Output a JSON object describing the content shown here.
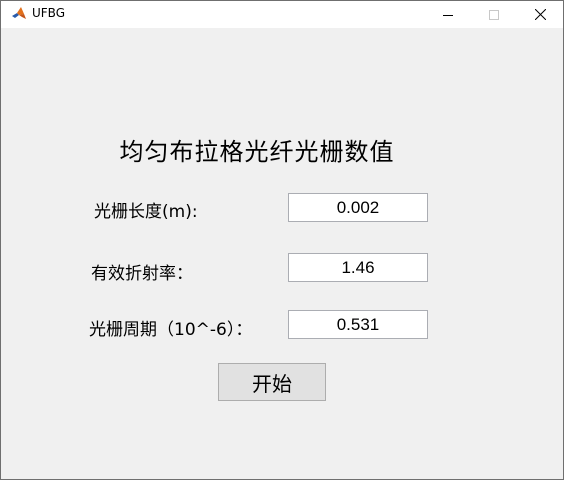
{
  "window": {
    "title": "UFBG",
    "icon": "matlab-icon",
    "controls": {
      "minimize_icon": "minimize-icon",
      "maximize_icon": "maximize-icon",
      "close_icon": "close-icon"
    }
  },
  "form": {
    "heading": "均匀布拉格光纤光栅数值",
    "fields": [
      {
        "label": "光栅长度(m):",
        "value": "0.002"
      },
      {
        "label": "有效折射率：",
        "value": "1.46"
      },
      {
        "label": "光栅周期（10^-6）：",
        "value": "0.531"
      }
    ],
    "start_button": "开始"
  },
  "colors": {
    "background": "#f0f0f0",
    "titlebar": "#ffffff",
    "button": "#e1e1e1",
    "field_border": "#abadb3"
  }
}
